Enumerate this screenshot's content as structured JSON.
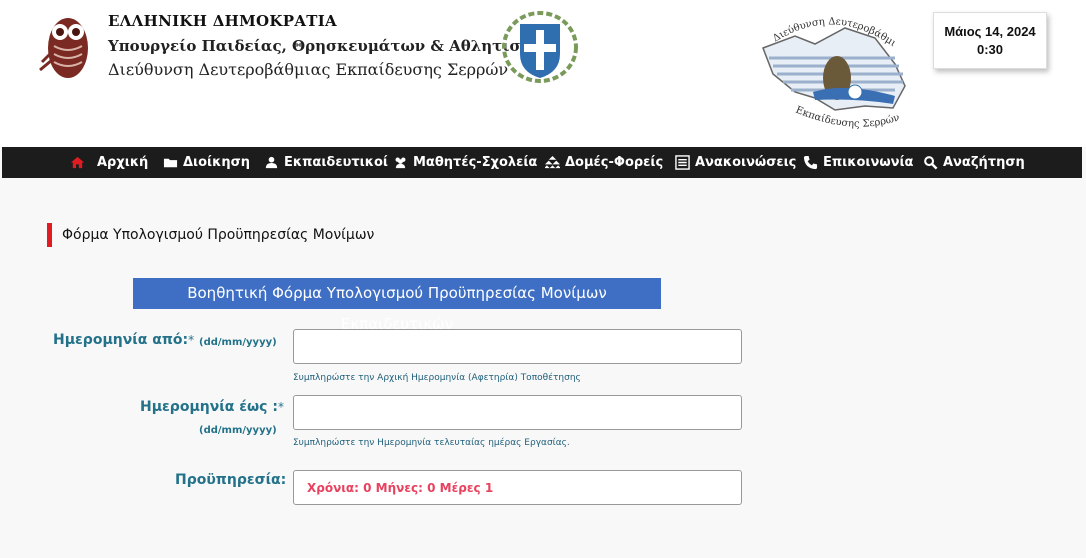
{
  "header": {
    "ministry_line1": "ΕΛΛΗΝΙΚΗ ΔΗΜΟΚΡΑΤΙΑ",
    "ministry_line2": "Υπουργείο Παιδείας, Θρησκευμάτων & Αθλητισμού",
    "ministry_line3": "Διεύθυνση Δευτεροβάθμιας Εκπαίδευσης Σερρών",
    "logo_text_top": "Διεύθυνση Δευτεροβάθμιας",
    "logo_text_bottom": "Εκπαίδευσης Σερρών",
    "clock": {
      "date": "Μάιος 14, 2024",
      "time": "0:30"
    }
  },
  "nav": {
    "items": [
      {
        "label": "Αρχική",
        "icon": "home-icon"
      },
      {
        "label": "Διοίκηση",
        "icon": "folder-icon"
      },
      {
        "label": "Εκπαιδευτικοί",
        "icon": "user-icon"
      },
      {
        "label": "Μαθητές-Σχολεία",
        "icon": "users-icon"
      },
      {
        "label": "Δομές-Φορείς",
        "icon": "sitemap-icon"
      },
      {
        "label": "Ανακοινώσεις",
        "icon": "list-icon"
      },
      {
        "label": "Επικοινωνία",
        "icon": "phone-icon"
      },
      {
        "label": "Αναζήτηση",
        "icon": "search-icon"
      }
    ]
  },
  "page": {
    "section_title": "Φόρμα Υπολογισμού Προϋπηρεσίας Μονίμων",
    "form_heading": "Βοηθητική Φόρμα Υπολογισμού Προϋπηρεσίας Μονίμων Εκπαιδευτικών"
  },
  "form": {
    "date_from": {
      "label": "Ημερομηνία από:",
      "required_mark": "*",
      "format": "(dd/mm/yyyy)",
      "value": "",
      "help": "Συμπληρώστε την Αρχική Ημερομηνία (Αφετηρία) Τοποθέτησης"
    },
    "date_to": {
      "label": "Ημερομηνία έως :",
      "required_mark": "*",
      "format": "(dd/mm/yyyy)",
      "value": "",
      "help": "Συμπληρώστε την Ημερομηνία τελευταίας ημέρας Εργασίας."
    },
    "result": {
      "label": "Προϋπηρεσία:",
      "value": "Χρόνια: 0 Μήνες: 0 Μέρες 1"
    }
  },
  "colors": {
    "navbar_bg": "#1c1c1c",
    "accent_red": "#e01b22",
    "heading_blue": "#3e6fc4",
    "label_teal": "#23728a",
    "result_pink": "#e8425e"
  }
}
